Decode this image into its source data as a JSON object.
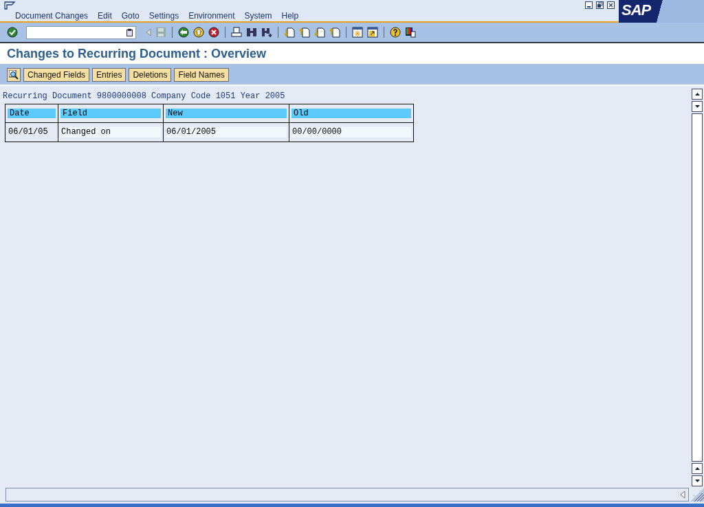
{
  "menu": [
    {
      "label": "Document Changes"
    },
    {
      "label": "Edit"
    },
    {
      "label": "Goto"
    },
    {
      "label": "Settings"
    },
    {
      "label": "Environment"
    },
    {
      "label": "System"
    },
    {
      "label": "Help"
    }
  ],
  "logo": "SAP",
  "title": "Changes to Recurring Document : Overview",
  "app_buttons": [
    {
      "label": "Changed Fields"
    },
    {
      "label": "Entries"
    },
    {
      "label": "Deletions"
    },
    {
      "label": "Field Names"
    }
  ],
  "info_line": "Recurring Document 9800000008 Company Code 1051 Year 2005",
  "table": {
    "columns": [
      "Date",
      "Field",
      "New",
      "Old"
    ],
    "rows": [
      [
        "06/01/05",
        "Changed on",
        "06/01/2005",
        "00/00/0000"
      ]
    ]
  }
}
